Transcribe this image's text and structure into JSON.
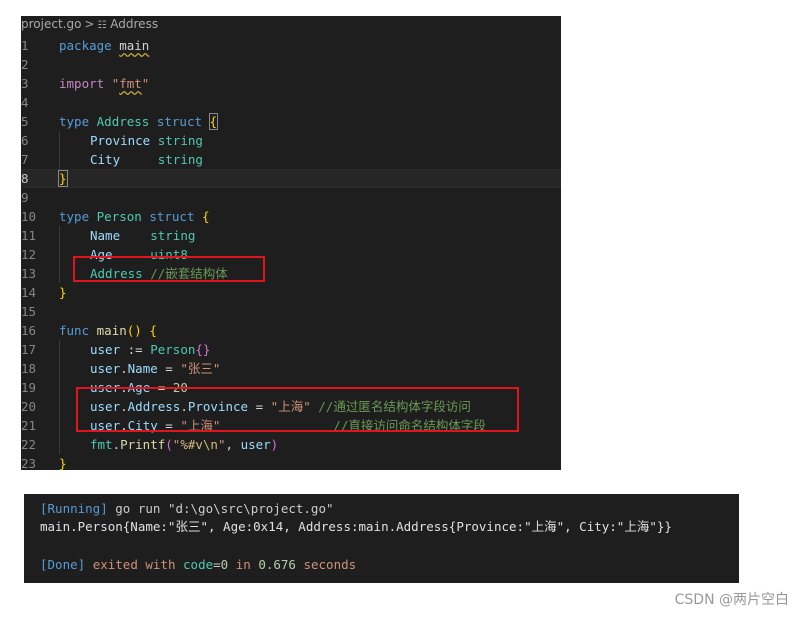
{
  "breadcrumb": {
    "file": "project.go",
    "symbol": "Address",
    "separator": ">"
  },
  "code_lines": [
    {
      "n": "1"
    },
    {
      "n": "2"
    },
    {
      "n": "3"
    },
    {
      "n": "4"
    },
    {
      "n": "5"
    },
    {
      "n": "6"
    },
    {
      "n": "7"
    },
    {
      "n": "8"
    },
    {
      "n": "9"
    },
    {
      "n": "10"
    },
    {
      "n": "11"
    },
    {
      "n": "12"
    },
    {
      "n": "13"
    },
    {
      "n": "14"
    },
    {
      "n": "15"
    },
    {
      "n": "16"
    },
    {
      "n": "17"
    },
    {
      "n": "18"
    },
    {
      "n": "19"
    },
    {
      "n": "20"
    },
    {
      "n": "21"
    },
    {
      "n": "22"
    },
    {
      "n": "23"
    }
  ],
  "code": {
    "package_kw": "package",
    "package_name": "main",
    "import_kw": "import",
    "import_q1": "\"",
    "import_path": "fmt",
    "import_q2": "\"",
    "type_kw": "type",
    "address_type": "Address",
    "struct_kw": "struct",
    "province_field": "Province",
    "string_type": "string",
    "city_field": "City",
    "person_type": "Person",
    "name_field": "Name",
    "age_field": "Age",
    "uint8_type": "uint8",
    "address_field": "Address",
    "address_comment": "//嵌套结构体",
    "func_kw": "func",
    "main_fn": "main",
    "user_var": "user",
    "decl_op": ":=",
    "person_lit": "Person",
    "name_value": "\"张三\"",
    "age_value": "20",
    "province_value": "\"上海\"",
    "province_comment": "//通过匿名结构体字段访问",
    "city_value": "\"上海\"",
    "city_comment": "//直接访问命名结构体字段",
    "fmt_pkg": "fmt",
    "printf_fn": "Printf",
    "format_str_start": "\"",
    "format_verb": "%#v\\n",
    "format_str_end": "\"",
    "brace_open": "{",
    "brace_close": "}",
    "paren_open": "(",
    "paren_close": ")",
    "empty_braces": "{}",
    "dot": ".",
    "eq": "=",
    "comma": ",",
    "parens": "()"
  },
  "terminal": {
    "running_label": "[Running]",
    "command": "go run \"d:\\go\\src\\project.go\"",
    "output": "main.Person{Name:\"张三\", Age:0x14, Address:main.Address{Province:\"上海\", City:\"上海\"}}",
    "done_label": "[Done]",
    "exited_text": "exited with",
    "code_label": "code",
    "eq": "=",
    "code_value": "0",
    "in_text": "in",
    "seconds_value": "0.676",
    "seconds_label": "seconds"
  },
  "watermark": "CSDN @两片空白",
  "colors": {
    "editor_bg": "#1e1e1e",
    "highlight_box": "#e0151d"
  }
}
